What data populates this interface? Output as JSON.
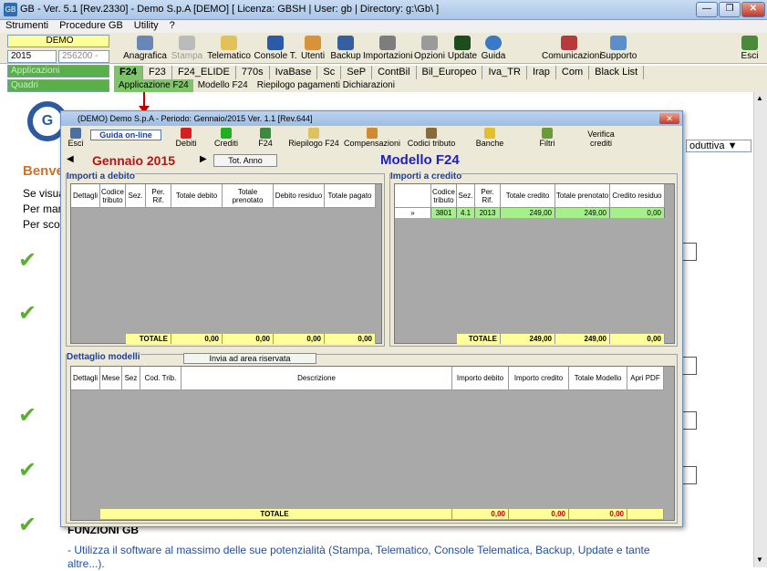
{
  "window": {
    "title": "GB - Ver. 5.1 [Rev.2330] -  Demo S.p.A [DEMO]     [ Licenza: GBSH | User: gb | Directory: g:\\Gb\\ ]"
  },
  "menu": [
    "Strumenti",
    "Procedure GB",
    "Utility",
    "?"
  ],
  "selectors": {
    "company": "DEMO",
    "year": "2015",
    "code": "256200 -",
    "app": "Applicazioni",
    "view": "Quadri"
  },
  "toolbar": [
    "Anagrafica",
    "Stampa",
    "Telematico",
    "Console T.",
    "Utenti",
    "Backup",
    "Importazioni",
    "Opzioni",
    "Update",
    "Guida",
    "Comunicazioni",
    "Supporto",
    "Esci"
  ],
  "tabs1": [
    "F24",
    "F23",
    "F24_ELIDE",
    "770s",
    "IvaBase",
    "Sc",
    "SeP",
    "ContBil",
    "Bil_Europeo",
    "Iva_TR",
    "Irap",
    "Com",
    "Black List"
  ],
  "tabs2": [
    "Applicazione F24",
    "Modello F24",
    "Riepilogo pagamenti Dichiarazioni"
  ],
  "background": {
    "heading": "Benve",
    "lines": [
      "Se visua",
      "Per mar",
      "Per scop"
    ],
    "right_select": "oduttiva",
    "funzioni": "FUNZIONI GB",
    "funzioni_text": "- Utilizza il software al massimo delle sue potenzialità (Stampa, Telematico, Console Telematica, Backup, Update e tante altre...)."
  },
  "dialog": {
    "title": "(DEMO) Demo S.p.A - Periodo: Gennaio/2015 Ver. 1.1 [Rev.644]",
    "toolbar": [
      "Esci",
      "Guida on-line",
      "Debiti",
      "Crediti",
      "F24",
      "Riepilogo F24",
      "Compensazioni",
      "Codici tributo",
      "Banche",
      "Filtri",
      "Verifica crediti"
    ],
    "period": "Gennaio 2015",
    "tot_anno": "Tot. Anno",
    "modello": "Modello F24",
    "debito": {
      "label": "Importi a debito",
      "headers": [
        "Dettagli",
        "Codice tributo",
        "Sez.",
        "Per. Rif.",
        "Totale debito",
        "Totale prenotato",
        "Debito residuo",
        "Totale pagato"
      ],
      "total_label": "TOTALE",
      "totals": [
        "0,00",
        "0,00",
        "0,00",
        "0,00"
      ]
    },
    "credito": {
      "label": "Importi a credito",
      "headers": [
        "Codice tributo",
        "Sez.",
        "Per. Rif.",
        "Totale credito",
        "Totale prenotato",
        "Credito residuo"
      ],
      "row": {
        "marker": "»",
        "codice": "3801",
        "sez": "4.1",
        "per": "2013",
        "totale": "249,00",
        "prenotato": "249,00",
        "residuo": "0,00"
      },
      "total_label": "TOTALE",
      "totals": [
        "249,00",
        "249,00",
        "0,00"
      ]
    },
    "dettaglio": {
      "label": "Dettaglio modelli",
      "send_button": "Invia ad area riservata",
      "headers": [
        "Dettagli",
        "Mese",
        "Sez",
        "Cod. Trib.",
        "Descrizione",
        "Importo debito",
        "Importo credito",
        "Totale Modello",
        "Apri PDF"
      ],
      "total_label": "TOTALE",
      "totals": [
        "0,00",
        "0,00",
        "0,00"
      ]
    }
  }
}
